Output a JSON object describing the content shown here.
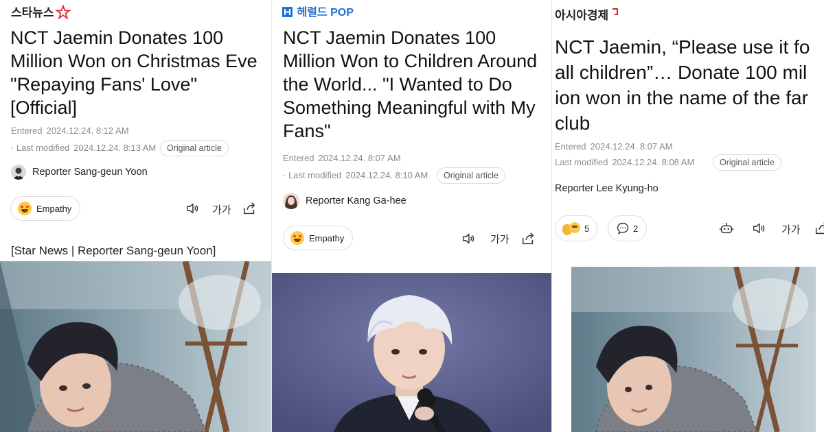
{
  "articles": [
    {
      "logo": "스타뉴스",
      "headline_lines": [
        "NCT Jaemin Donates 100",
        "Million Won on Christmas Eve",
        "\"Repaying Fans' Love\"",
        "[Official]"
      ],
      "entered_label": "Entered",
      "entered_value": "2024.12.24. 8:12 AM",
      "modified_label": "Last modified",
      "modified_value": "2024.12.24. 8:13 AM",
      "original_label": "Original article",
      "reporter": "Reporter Sang-geun Yoon",
      "empathy_label": "Empathy",
      "fontsize_label": "가가",
      "source_line": "[Star News | Reporter Sang-geun Yoon]"
    },
    {
      "logo": "헤럴드",
      "logo_suffix": "POP",
      "headline_lines": [
        "NCT Jaemin Donates 100",
        "Million Won to Children Around",
        "the World... \"I Wanted to Do",
        "Something Meaningful with My",
        "Fans\""
      ],
      "entered_label": "Entered",
      "entered_value": "2024.12.24. 8:07 AM",
      "modified_label": "Last modified",
      "modified_value": "2024.12.24. 8:10 AM",
      "original_label": "Original article",
      "reporter": "Reporter Kang Ga-hee",
      "empathy_label": "Empathy",
      "fontsize_label": "가가"
    },
    {
      "logo": "아시아경제",
      "headline_lines": [
        "NCT Jaemin, “Please use it fo",
        "all children”… Donate 100 mil",
        "ion won in the name of the far",
        "club"
      ],
      "entered_label": "Entered",
      "entered_value": "2024.12.24. 8:07 AM",
      "modified_label": "Last modified",
      "modified_value": "2024.12.24. 8:08 AM",
      "original_label": "Original article",
      "reporter": "Reporter Lee Kyung-ho",
      "reaction_count": "5",
      "comment_count": "2",
      "fontsize_label": "가가"
    }
  ],
  "colors": {
    "starnews_red": "#e3262e",
    "herald_blue": "#1f6fd6",
    "asia_red": "#d7202a",
    "meta_gray": "#8a8a8a"
  }
}
